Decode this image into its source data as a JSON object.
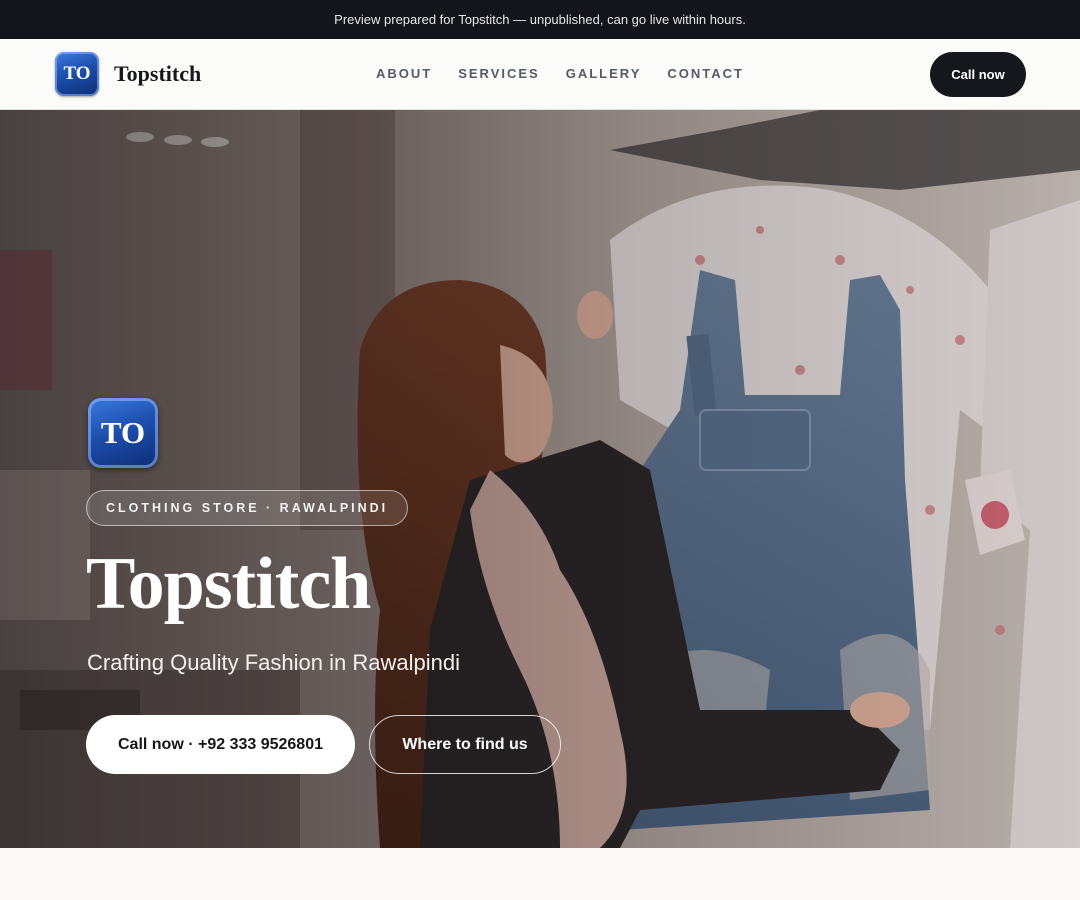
{
  "topbar": {
    "text": "Preview prepared for Topstitch — unpublished, can go live within hours."
  },
  "nav": {
    "logo_initials": "TO",
    "brand": "Topstitch",
    "links": [
      "ABOUT",
      "SERVICES",
      "GALLERY",
      "CONTACT"
    ],
    "cta_label": "Call now"
  },
  "hero": {
    "logo_initials": "TO",
    "tag": "CLOTHING STORE · RAWALPINDI",
    "title": "Topstitch",
    "subtitle": "Crafting Quality Fashion in Rawalpindi",
    "primary_button": "Call now · +92 333 9526801",
    "secondary_button": "Where to find us",
    "image": "photo of a woman browsing a denim dungaree dress on a clothing rack in a boutique"
  },
  "colors": {
    "topbar_bg": "#13151a",
    "cta_bg": "#16171c",
    "logo_blue": "#1d4fae",
    "page_bg": "#faf9f6"
  }
}
